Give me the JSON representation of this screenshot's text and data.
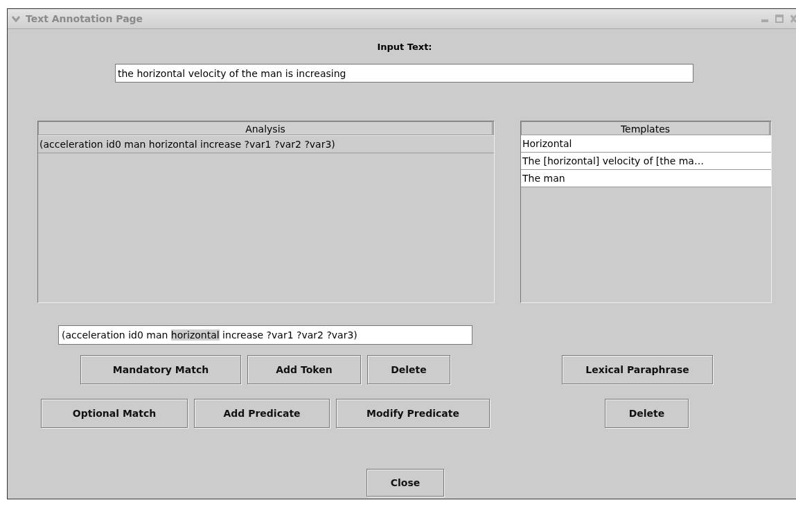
{
  "window": {
    "title": "Text Annotation Page"
  },
  "input": {
    "label": "Input Text:",
    "value": "the horizontal velocity of the man is increasing"
  },
  "analysis": {
    "header": "Analysis",
    "rows": [
      {
        "text": "(acceleration id0 man horizontal increase ?var1 ?var2 ?var3)",
        "selected": true
      }
    ]
  },
  "templates": {
    "header": "Templates",
    "rows": [
      {
        "text": "Horizontal",
        "selected": false
      },
      {
        "text": "The [horizontal] velocity of [the ma…",
        "selected": false
      },
      {
        "text": "The man",
        "selected": false
      }
    ]
  },
  "expression": {
    "before": "(acceleration id0 man ",
    "highlighted": "horizontal",
    "after": " increase ?var1 ?var2 ?var3)"
  },
  "analysis_buttons": [
    [
      "Mandatory Match",
      "Add Token",
      "Delete"
    ],
    [
      "Optional Match",
      "Add Predicate",
      "Modify Predicate"
    ]
  ],
  "template_buttons": [
    "Lexical Paraphrase",
    "Delete"
  ],
  "close_button": "Close"
}
